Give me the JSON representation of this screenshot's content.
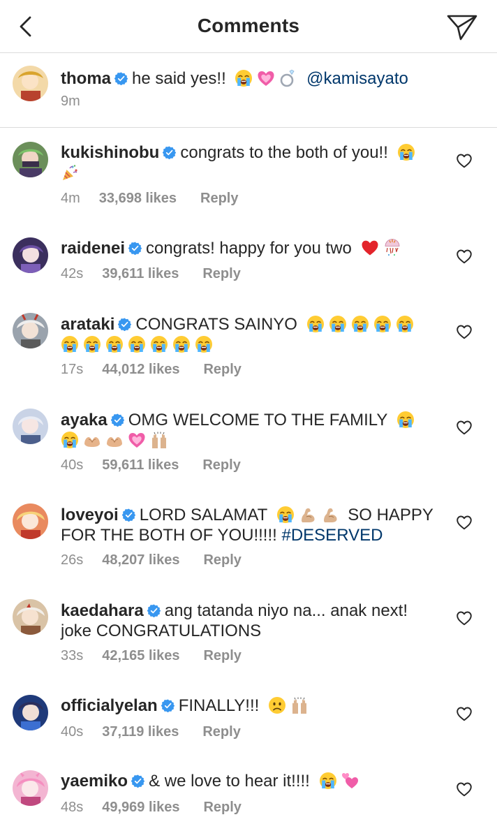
{
  "header": {
    "title": "Comments",
    "back_icon": "chevron-left-icon",
    "send_icon": "paper-plane-icon"
  },
  "caption": {
    "username": "thoma",
    "text": "he said yes!!",
    "emojis": [
      "loudly-crying-face",
      "growing-heart",
      "ring"
    ],
    "mention": "@kamisayato",
    "time": "9m"
  },
  "comments": [
    {
      "username": "kukishinobu",
      "line1": "congrats to the both of you!!",
      "line2": "",
      "emojis": [
        "loudly-crying-face",
        "party-popper"
      ],
      "time": "4m",
      "likes": "33,698 likes",
      "reply": "Reply"
    },
    {
      "username": "raidenei",
      "line1": "congrats! happy for you two",
      "line2": "",
      "emojis": [
        "red-heart",
        "confetti-ball"
      ],
      "time": "42s",
      "likes": "39,611 likes",
      "reply": "Reply"
    },
    {
      "username": "arataki",
      "line1": "CONGRATS SAINYO",
      "line2": "",
      "emojis": [
        "loudly-crying-face x12"
      ],
      "time": "17s",
      "likes": "44,012 likes",
      "reply": "Reply"
    },
    {
      "username": "ayaka",
      "line1": "OMG WELCOME TO THE FAMILY",
      "line2": "",
      "emojis": [
        "loudly-crying-face",
        "loudly-crying-face",
        "heart-hands",
        "heart-hands",
        "growing-heart",
        "raising-hands"
      ],
      "time": "40s",
      "likes": "59,611 likes",
      "reply": "Reply"
    },
    {
      "username": "loveyoi",
      "line1": "LORD SALAMAT",
      "line1b": "SO HAPPY",
      "line2": "FOR THE BOTH OF YOU!!!!!",
      "hashtag": "#DESERVED",
      "emojis": [
        "loudly-crying-face",
        "flexed-biceps",
        "flexed-biceps"
      ],
      "time": "26s",
      "likes": "48,207 likes",
      "reply": "Reply"
    },
    {
      "username": "kaedahara",
      "line1": "ang tatanda niyo na... anak next!",
      "line2": "joke CONGRATULATIONS",
      "emojis": [],
      "time": "33s",
      "likes": "42,165 likes",
      "reply": "Reply"
    },
    {
      "username": "officialyelan",
      "line1": "FINALLY!!!",
      "line2": "",
      "emojis": [
        "slightly-frowning-face",
        "raising-hands"
      ],
      "time": "40s",
      "likes": "37,119 likes",
      "reply": "Reply"
    },
    {
      "username": "yaemiko",
      "line1": "& we love to hear it!!!!",
      "line2": "",
      "emojis": [
        "loudly-crying-face",
        "two-hearts"
      ],
      "time": "48s",
      "likes": "49,969 likes",
      "reply": "Reply"
    }
  ],
  "colors": {
    "text": "#262626",
    "secondary": "#8e8e8e",
    "link": "#00376b",
    "verified": "#3897f0",
    "divider": "#dbdbdb"
  }
}
